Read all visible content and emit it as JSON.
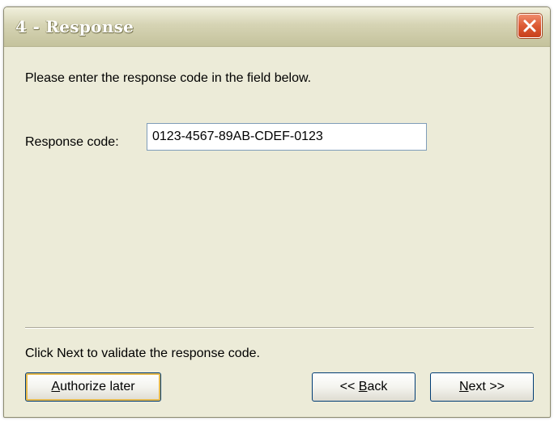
{
  "window": {
    "title": "4 - Response"
  },
  "content": {
    "instruction": "Please enter the response code in the field below.",
    "response_code_label": "Response code:",
    "response_code_value": "0123-4567-89AB-CDEF-0123",
    "footer_text": "Click Next to validate the response code."
  },
  "buttons": {
    "authorize_later": {
      "mnemonic": "A",
      "rest": "uthorize later"
    },
    "back": {
      "prefix": "<< ",
      "mnemonic": "B",
      "rest": "ack"
    },
    "next": {
      "mnemonic": "N",
      "rest": "ext >>"
    }
  },
  "icons": {
    "close": "close-icon"
  },
  "colors": {
    "window_bg": "#ecebd8",
    "title_text": "#ffffff",
    "close_button": "#dc5a34",
    "input_border": "#7f9db9",
    "button_border": "#003c74"
  }
}
